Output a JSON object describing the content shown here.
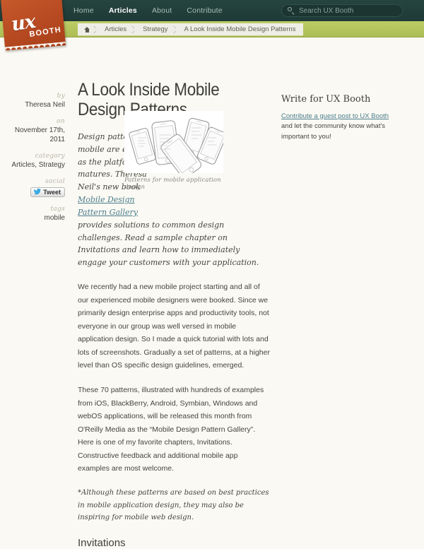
{
  "site": {
    "logo_ux": "ux",
    "logo_booth": "BOOTH"
  },
  "header": {
    "nav": [
      {
        "label": "Home",
        "active": false
      },
      {
        "label": "Articles",
        "active": true
      },
      {
        "label": "About",
        "active": false
      },
      {
        "label": "Contribute",
        "active": false
      }
    ],
    "search": {
      "placeholder": "Search UX Booth",
      "value": ""
    }
  },
  "breadcrumb": [
    {
      "label": "",
      "icon": "home-icon"
    },
    {
      "label": "Articles"
    },
    {
      "label": "Strategy"
    },
    {
      "label": "A Look Inside Mobile Design Patterns"
    }
  ],
  "article": {
    "title": "A Look Inside Mobile Design Patterns",
    "meta": {
      "by_label": "by",
      "by_value": "Theresa Neil",
      "on_label": "on",
      "on_value": "November 17th, 2011",
      "category_label": "category",
      "category_value": "Articles, Strategy",
      "social_label": "social",
      "tweet_label": "Tweet",
      "tags_label": "tags",
      "tags_value": "mobile"
    },
    "lead_part1": "Design patterns for mobile are emerging as the platform matures. Theresa Neil's new book ",
    "lead_link": "Mobile Design Pattern Gallery",
    "lead_part2": " provides solutions to common design challenges. Read a sample chapter on Invitations and learn how to immediately engage your customers with your application.",
    "figure_caption": "Patterns for mobile application design",
    "paragraphs": [
      "We recently had a new mobile project starting and all of our experienced mobile designers were booked. Since we primarily design enterprise apps and productivity tools, not everyone in our group was well versed in mobile application design. So I made a quick tutorial with lots and lots of screenshots. Gradually a set of patterns, at a higher level than OS specific design guidelines, emerged.",
      "These 70 patterns, illustrated with hundreds of examples from iOS, BlackBerry, Android, Symbian, Windows and webOS applications, will be released this month from O'Reilly Media as the “Mobile Design Pattern Gallery”. Here is one of my favorite chapters, Invitations. Constructive feedback and additional mobile app examples are most welcome."
    ],
    "note": "*Although these patterns are based on best practices in mobile application design, they may also be inspiring for mobile web design.",
    "next_heading": "Invitations"
  },
  "sidebar": {
    "heading": "Write for UX Booth",
    "link": "Contribute a guest post to UX Booth",
    "text_after": " and let the community know what's important to you!"
  },
  "colors": {
    "header_bg": "#23403c",
    "crumb_bar": "#b7c75f",
    "logo_orange": "#b74a21",
    "link": "#4c7d8c",
    "page_bg": "#faf9f3",
    "twitter_blue": "#3aa9e0"
  }
}
